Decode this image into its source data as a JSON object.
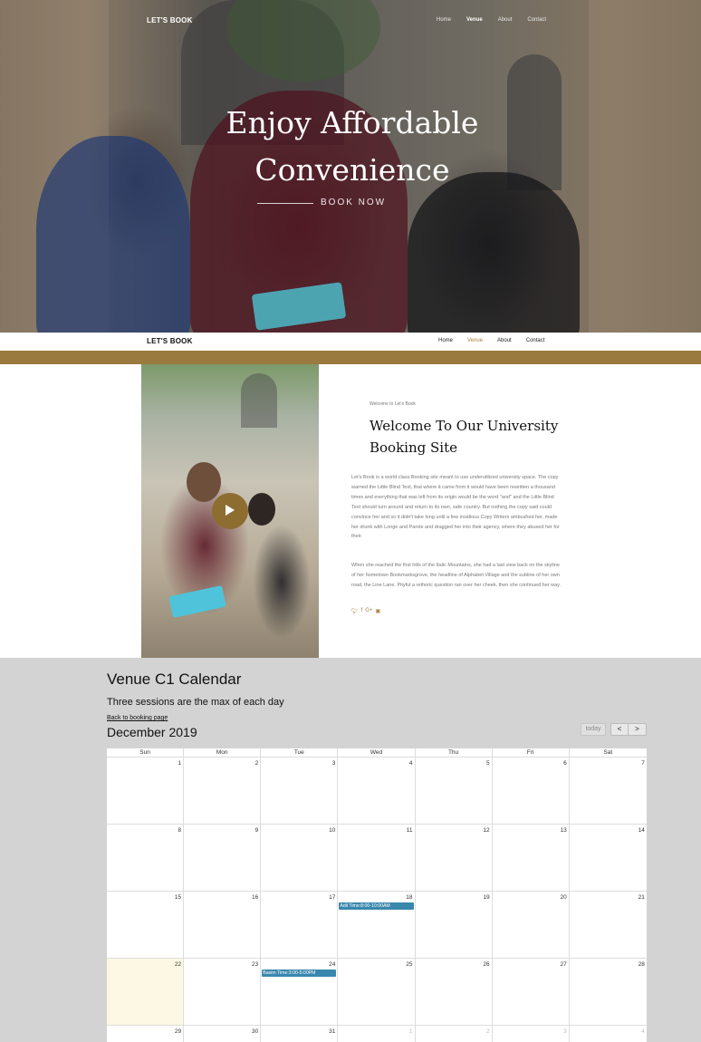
{
  "brand": "LET'S BOOK",
  "nav": [
    {
      "label": "Home",
      "active": false
    },
    {
      "label": "Venue",
      "active": true
    },
    {
      "label": "About",
      "active": false
    },
    {
      "label": "Contact",
      "active": false
    }
  ],
  "hero": {
    "title_line1": "Enjoy Affordable",
    "title_line2": "Convenience",
    "cta": "BOOK NOW"
  },
  "welcome": {
    "small": "Welcome to Let's Book",
    "title": "Welcome To Our University Booking Site",
    "paragraph1": "Let's Book is a world class Booking site meant to use underutilized university space. The copy warned the Little Blind Text, that where it came from it would have been rewritten a thousand times and everything that was left from its origin would be the word \"and\" and the Little Blind Text should turn around and return to its own, safe country. But nothing the copy said could convince her and so it didn't take long until a few insidious Copy Writers ambushed her, made her drunk with Longe and Parole and dragged her into their agency, where they abused her for their.",
    "paragraph2": "When she reached the first hills of the Italic Mountains, she had a last view back on the skyline of her hometown Bookmarksgrove, the headline of Alphabet Village and the subline of her own road, the Line Lane. Pityful a rethoric question ran over her cheek, then she continued her way.",
    "social_icons": [
      "twitter-icon",
      "facebook-icon",
      "google-plus-icon",
      "instagram-icon"
    ]
  },
  "calendar": {
    "title": "Venue C1 Calendar",
    "subtitle": "Three sessions are the max of each day",
    "back_link": "Back to booking page",
    "month": "December 2019",
    "today_label": "today",
    "prev_label": "<",
    "next_label": ">",
    "weekdays": [
      "Sun",
      "Mon",
      "Tue",
      "Wed",
      "Thu",
      "Fri",
      "Sat"
    ],
    "weeks": [
      [
        {
          "d": "1"
        },
        {
          "d": "2"
        },
        {
          "d": "3"
        },
        {
          "d": "4"
        },
        {
          "d": "5"
        },
        {
          "d": "6"
        },
        {
          "d": "7"
        }
      ],
      [
        {
          "d": "8"
        },
        {
          "d": "9"
        },
        {
          "d": "10"
        },
        {
          "d": "11"
        },
        {
          "d": "12"
        },
        {
          "d": "13"
        },
        {
          "d": "14"
        }
      ],
      [
        {
          "d": "15"
        },
        {
          "d": "16"
        },
        {
          "d": "17"
        },
        {
          "d": "18",
          "event": "Adil Time:8:00-10:00AM"
        },
        {
          "d": "19"
        },
        {
          "d": "20"
        },
        {
          "d": "21"
        }
      ],
      [
        {
          "d": "22",
          "today": true
        },
        {
          "d": "23"
        },
        {
          "d": "24",
          "event": "Basim Time:3:00-5:00PM"
        },
        {
          "d": "25"
        },
        {
          "d": "26"
        },
        {
          "d": "27"
        },
        {
          "d": "28"
        }
      ],
      [
        {
          "d": "29"
        },
        {
          "d": "30"
        },
        {
          "d": "31"
        },
        {
          "d": "1",
          "other": true
        },
        {
          "d": "2",
          "other": true
        },
        {
          "d": "3",
          "other": true
        },
        {
          "d": "4",
          "other": true
        }
      ]
    ],
    "event_color": "#3a87ad"
  }
}
